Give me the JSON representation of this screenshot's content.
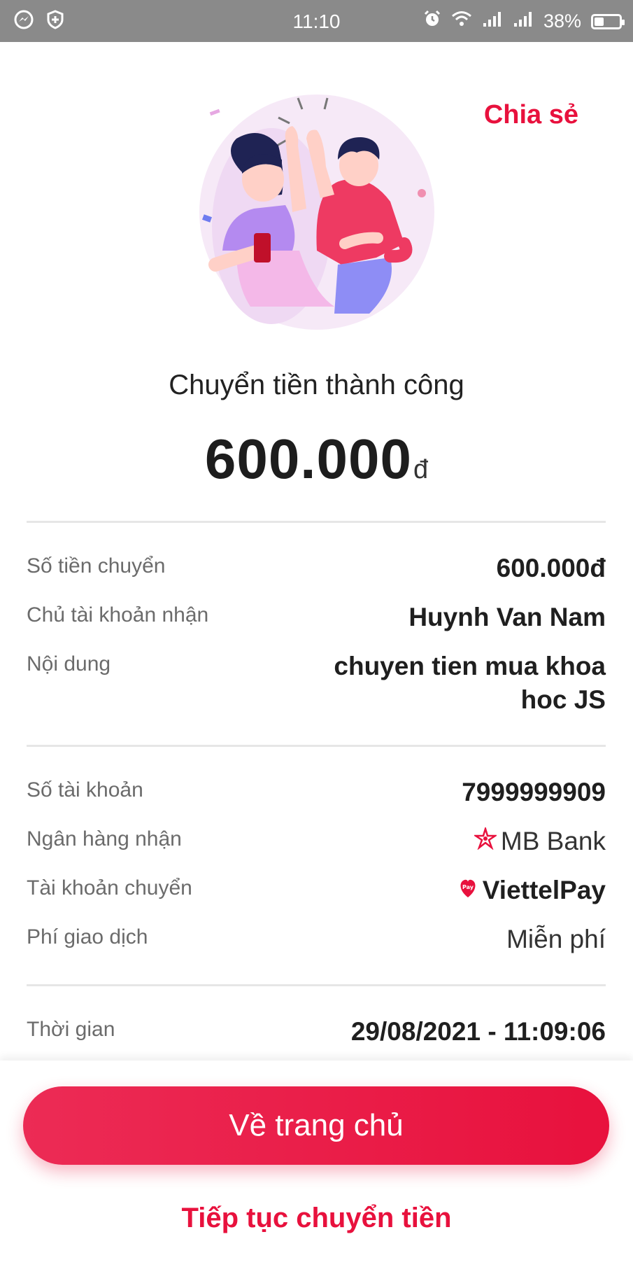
{
  "status_bar": {
    "time": "11:10",
    "battery": "38%",
    "left_icons": [
      "messenger-icon",
      "shield-icon"
    ],
    "right_icons": [
      "alarm-icon",
      "wifi-icon",
      "signal-icon",
      "signal-icon",
      "battery-icon"
    ]
  },
  "header": {
    "share_label": "Chia sẻ"
  },
  "result": {
    "title": "Chuyển tiền thành công",
    "amount": "600.000",
    "currency": "đ"
  },
  "details_group1": [
    {
      "label": "Số tiền chuyển",
      "value": "600.000đ"
    },
    {
      "label": "Chủ tài khoản nhận",
      "value": "Huynh Van Nam"
    },
    {
      "label": "Nội dung",
      "value_line1": "chuyen tien mua khoa",
      "value_line2": "hoc JS"
    }
  ],
  "details_group2": [
    {
      "label": "Số tài khoản",
      "value": "7999999909"
    },
    {
      "label": "Ngân hàng nhận",
      "value": "MB Bank",
      "icon": "mbbank-logo-icon"
    },
    {
      "label": "Tài khoản chuyển",
      "value": "ViettelPay",
      "icon": "viettelpay-logo-icon"
    },
    {
      "label": "Phí giao dịch",
      "value": "Miễn phí"
    }
  ],
  "details_group3": [
    {
      "label": "Thời gian",
      "value": "29/08/2021 - 11:09:06"
    }
  ],
  "actions": {
    "home_button": "Về trang chủ",
    "continue_link": "Tiếp tục chuyển tiền"
  },
  "colors": {
    "accent": "#e8113d",
    "status_bar": "#8a8a8a"
  }
}
